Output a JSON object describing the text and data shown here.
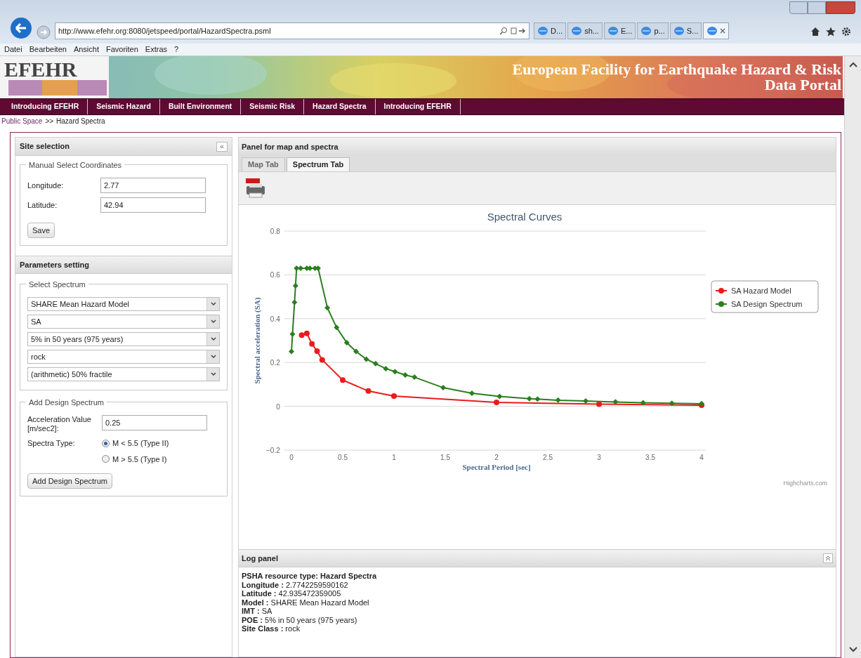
{
  "browser": {
    "url": "http://www.efehr.org:8080/jetspeed/portal/HazardSpectra.psml",
    "tabs": [
      {
        "label": "D...",
        "selected": false
      },
      {
        "label": "sh...",
        "selected": false
      },
      {
        "label": "E...",
        "selected": false
      },
      {
        "label": "p...",
        "selected": false
      },
      {
        "label": "S...",
        "selected": false
      },
      {
        "selected": true
      }
    ],
    "menu": [
      "Datei",
      "Bearbeiten",
      "Ansicht",
      "Favoriten",
      "Extras",
      "?"
    ]
  },
  "banner": {
    "logo": "EFEHR",
    "title_line_1": "European Facility for Earthquake Hazard & Risk",
    "title_line_2": "Data Portal"
  },
  "nav": [
    "Introducing EFEHR",
    "Seismic Hazard",
    "Built Environment",
    "Seismic Risk",
    "Hazard Spectra",
    "Introducing EFEHR"
  ],
  "breadcrumb": {
    "link": "Public Space",
    "separator": ">>",
    "current": "Hazard Spectra"
  },
  "site_selection": {
    "title": "Site selection",
    "collapse": "«",
    "fieldset": "Manual Select Coordinates",
    "fields": [
      {
        "label": "Longitude:",
        "value": "2.77"
      },
      {
        "label": "Latitude:",
        "value": "42.94"
      }
    ],
    "button": "Save"
  },
  "parameters": {
    "title": "Parameters setting",
    "fieldset": "Select Spectrum",
    "selects": [
      "SHARE Mean Hazard Model",
      "SA",
      "5% in 50 years (975 years)",
      "rock",
      "(arithmetic) 50% fractile"
    ]
  },
  "design": {
    "fieldset": "Add Design Spectrum",
    "accel_label": "Acceleration Value [m/sec2]:",
    "accel_value": "0.25",
    "type_label": "Spectra Type:",
    "options": [
      {
        "label": "M < 5.5 (Type II)",
        "selected": true
      },
      {
        "label": "M > 5.5 (Type I)",
        "selected": false
      }
    ],
    "button": "Add Design Spectrum"
  },
  "main_panel": {
    "title": "Panel for map and spectra",
    "tabs": [
      {
        "label": "Map Tab",
        "selected": false
      },
      {
        "label": "Spectrum Tab",
        "selected": true
      }
    ],
    "chart_data": {
      "type": "line",
      "title": "Spectral Curves",
      "xlabel": "Spectral Period [sec]",
      "ylabel": "Spectral acceleration (SA)",
      "xlim": [
        -0.07,
        4.04
      ],
      "ylim": [
        -0.2,
        0.8
      ],
      "grid": true,
      "legend": true,
      "xticks": [
        0,
        0.5,
        1,
        1.5,
        2,
        2.5,
        3,
        3.5,
        4
      ],
      "yticks": [
        {
          "value": -0.2,
          "label": "−0.2"
        },
        0,
        0.2,
        0.4,
        0.6,
        0.8
      ],
      "series": [
        {
          "name": "SA Hazard Model",
          "color": "#e81c1c",
          "marker": "circle",
          "x": [
            0.1,
            0.15,
            0.2,
            0.25,
            0.3,
            0.5,
            0.75,
            1,
            2,
            3,
            4
          ],
          "values": [
            0.325,
            0.333,
            0.285,
            0.252,
            0.212,
            0.12,
            0.07,
            0.047,
            0.018,
            0.01,
            0.005
          ]
        },
        {
          "name": "SA Design Spectrum",
          "color": "#2a7f1e",
          "marker": "diamond",
          "x": [
            0,
            0.01,
            0.03,
            0.04,
            0.05,
            0.09,
            0.15,
            0.18,
            0.23,
            0.26,
            0.35,
            0.44,
            0.54,
            0.63,
            0.73,
            0.82,
            0.92,
            1.01,
            1.11,
            1.2,
            1.48,
            1.76,
            2.03,
            2.32,
            2.4,
            2.6,
            2.87,
            3.16,
            3.43,
            3.71,
            4
          ],
          "values": [
            0.25,
            0.33,
            0.475,
            0.55,
            0.63,
            0.63,
            0.63,
            0.63,
            0.63,
            0.63,
            0.45,
            0.36,
            0.29,
            0.25,
            0.215,
            0.195,
            0.172,
            0.158,
            0.143,
            0.133,
            0.085,
            0.06,
            0.045,
            0.035,
            0.033,
            0.028,
            0.024,
            0.02,
            0.016,
            0.014,
            0.012
          ]
        }
      ]
    },
    "credit": "Highcharts.com"
  },
  "log": {
    "title": "Log panel",
    "lines": [
      "PSHA resource type: Hazard Spectra",
      "**Longitude :** 2.7742259590162",
      "**Latitude :** 42.935472359005",
      "**Model :** SHARE Mean Hazard Model",
      "**IMT :** SA",
      "**POE :** 5% in 50 years (975 years)",
      "**Site Class :** rock"
    ]
  }
}
